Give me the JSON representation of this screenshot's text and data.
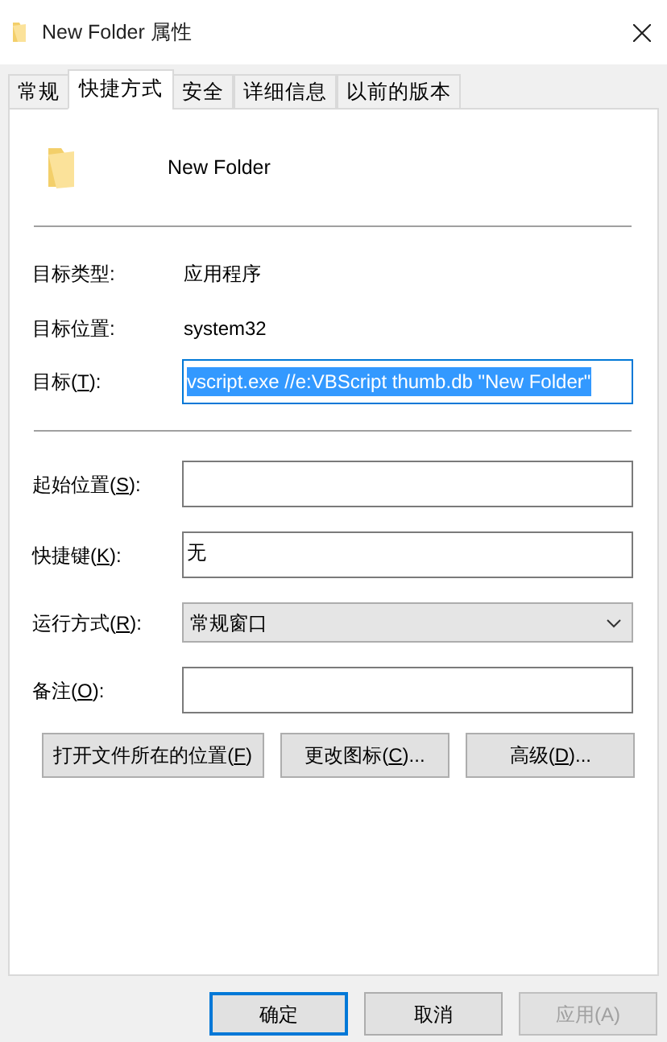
{
  "window": {
    "title": "New Folder 属性"
  },
  "tabs": [
    {
      "label": "常规",
      "selected": false
    },
    {
      "label": "快捷方式",
      "selected": true
    },
    {
      "label": "安全",
      "selected": false
    },
    {
      "label": "详细信息",
      "selected": false
    },
    {
      "label": "以前的版本",
      "selected": false
    }
  ],
  "shortcut_name": "New Folder",
  "info": [
    {
      "label": "目标类型:",
      "value": "应用程序"
    },
    {
      "label": "目标位置:",
      "value": "system32"
    }
  ],
  "target": {
    "label": {
      "before": "目标(",
      "key": "T",
      "after": "):"
    },
    "value": "vscript.exe //e:VBScript thumb.db \"New Folder\"",
    "selected": true
  },
  "fields": [
    {
      "kind": "text",
      "label": {
        "before": "起始位置(",
        "key": "S",
        "after": "):"
      }
    },
    {
      "kind": "text",
      "label": {
        "before": "快捷键(",
        "key": "K",
        "after": "):"
      },
      "value": "无"
    },
    {
      "kind": "select",
      "label": {
        "before": "运行方式(",
        "key": "R",
        "after": "):"
      },
      "value": "常规窗口"
    },
    {
      "kind": "text",
      "label": {
        "before": "备注(",
        "key": "O",
        "after": "):"
      }
    }
  ],
  "actions": [
    {
      "before": "打开文件所在的位置(",
      "key": "F",
      "after": ")"
    },
    {
      "before": "更改图标(",
      "key": "C",
      "after": ")..."
    },
    {
      "before": "高级(",
      "key": "D",
      "after": ")..."
    }
  ],
  "buttons": [
    {
      "label": "确定",
      "default": true,
      "disabled": false
    },
    {
      "label": "取消",
      "default": false,
      "disabled": false
    },
    {
      "label": "应用(A)",
      "default": false,
      "disabled": true
    }
  ]
}
